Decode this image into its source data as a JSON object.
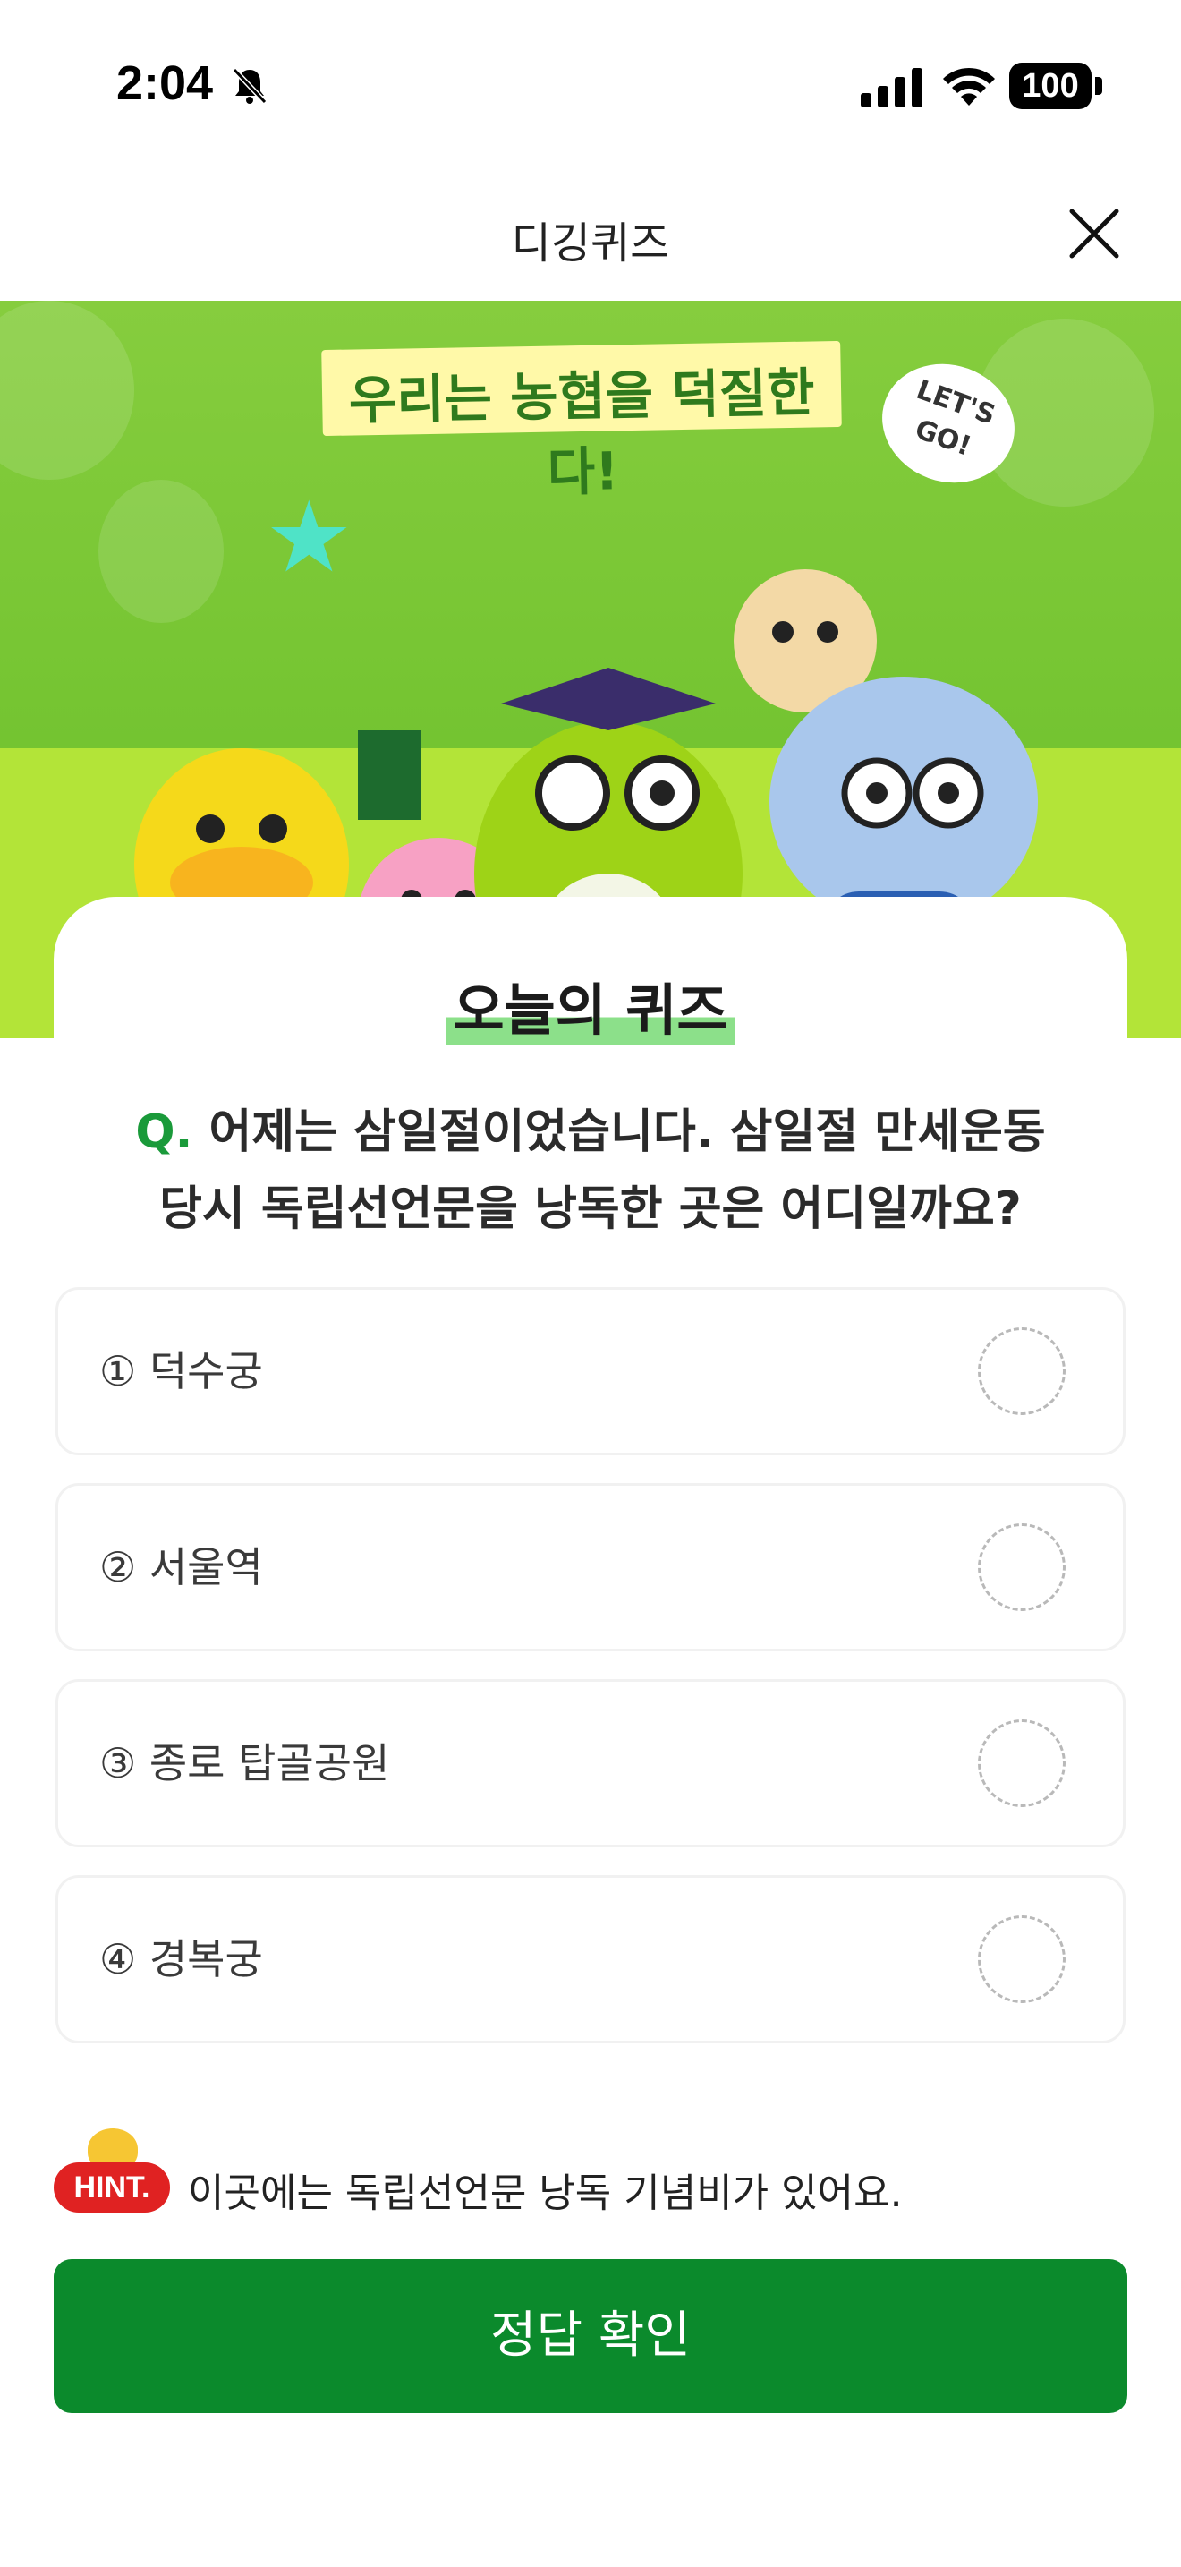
{
  "status_bar": {
    "time": "2:04",
    "battery": "100"
  },
  "nav": {
    "title": "디깅퀴즈"
  },
  "banner": {
    "headline": "우리는 농협을 덕질한다!",
    "bubble": "LET'S GO!"
  },
  "quiz": {
    "card_title": "오늘의 퀴즈",
    "question_prefix": "Q.",
    "question_line1": "어제는 삼일절이었습니다. 삼일절 만세운동",
    "question_line2": "당시 독립선언문을 낭독한 곳은 어디일까요?",
    "options": [
      {
        "label": "① 덕수궁"
      },
      {
        "label": "② 서울역"
      },
      {
        "label": "③ 종로 탑골공원"
      },
      {
        "label": "④ 경복궁"
      }
    ],
    "hint_badge": "HINT.",
    "hint_text": "이곳에는 독립선언문 낭독 기념비가 있어요.",
    "submit_label": "정답 확인"
  },
  "colors": {
    "primary_green": "#0b8a2c",
    "hint_red": "#e02222",
    "banner_green": "#74c431"
  }
}
